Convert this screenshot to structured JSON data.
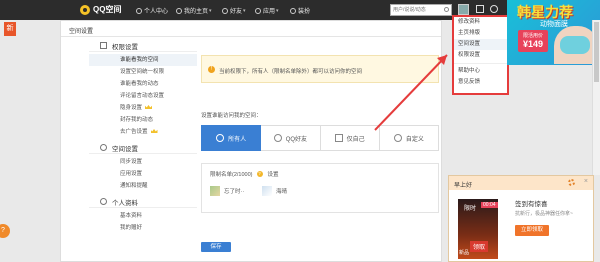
{
  "topbar": {
    "brand": "QQ空间",
    "nav": [
      {
        "label": "个人中心",
        "icon": "person-icon",
        "caret": ""
      },
      {
        "label": "我的主页",
        "icon": "home-icon",
        "caret": "▾"
      },
      {
        "label": "好友",
        "icon": "friends-icon",
        "caret": "▾"
      },
      {
        "label": "应用",
        "icon": "apps-icon",
        "caret": "▾"
      },
      {
        "label": "装扮",
        "icon": "dress-icon",
        "caret": ""
      }
    ],
    "search_placeholder": "用户/说说/动态"
  },
  "leftedge": {
    "badge": "新",
    "help": "?"
  },
  "panel": {
    "title": "空间设置",
    "sections": [
      {
        "title": "权限设置",
        "items": [
          {
            "label": "谁能看我的空间",
            "active": true,
            "crown": false
          },
          {
            "label": "设置空间统一权限",
            "active": false,
            "crown": false
          },
          {
            "label": "谁能看我的动态",
            "active": false,
            "crown": false
          },
          {
            "label": "评论留言动态设置",
            "active": false,
            "crown": false
          },
          {
            "label": "隐身设置",
            "active": false,
            "crown": true
          },
          {
            "label": "封存我的动态",
            "active": false,
            "crown": false
          },
          {
            "label": "去广告设置",
            "active": false,
            "crown": true
          }
        ]
      },
      {
        "title": "空间设置",
        "items": [
          {
            "label": "同步设置",
            "active": false,
            "crown": false
          },
          {
            "label": "应用设置",
            "active": false,
            "crown": false
          },
          {
            "label": "通知和提醒",
            "active": false,
            "crown": false
          }
        ]
      },
      {
        "title": "个人资料",
        "items": [
          {
            "label": "基本资料",
            "active": false,
            "crown": false
          },
          {
            "label": "我的赠好",
            "active": false,
            "crown": false
          }
        ]
      }
    ]
  },
  "content": {
    "notice": "当前权限下，所有人（限制名单除外）都可以访问你的空间",
    "question": "设置谁能访问我的空间：",
    "options": [
      {
        "label": "所有人",
        "selected": true
      },
      {
        "label": "QQ好友",
        "selected": false
      },
      {
        "label": "仅自己",
        "selected": false
      },
      {
        "label": "自定义",
        "selected": false
      }
    ],
    "whitelist_title": "限制名单(2/1000)",
    "whitelist_settings": "设置",
    "entries": [
      {
        "name": "忘了时··"
      },
      {
        "name": "海晴"
      }
    ],
    "save_label": "保存"
  },
  "dropdown": {
    "items": [
      {
        "label": "修改资料",
        "highlighted": false
      },
      {
        "label": "主页排版",
        "highlighted": false
      },
      {
        "label": "空间设置",
        "highlighted": true
      },
      {
        "label": "权限设置",
        "highlighted": false
      },
      {
        "label": "帮助中心",
        "highlighted": false
      },
      {
        "label": "意见反馈",
        "highlighted": false
      }
    ]
  },
  "ad": {
    "headline": "韩星力荐",
    "subline": "动物面膜",
    "price_label": "限活用价",
    "price": "¥149"
  },
  "popup": {
    "header": "早上好",
    "title": "签到有惊喜",
    "desc": "抗新行，极品神器任你拿~",
    "claim": "立即领取",
    "img_limited": "限时",
    "img_time": "00:04",
    "img_stamp": "领取",
    "img_new": "新品"
  },
  "colors": {
    "accent": "#3a7fd3",
    "topbar": "#2c2c2c",
    "highlight_red": "#e53c3c",
    "claim_orange": "#f0742a"
  }
}
